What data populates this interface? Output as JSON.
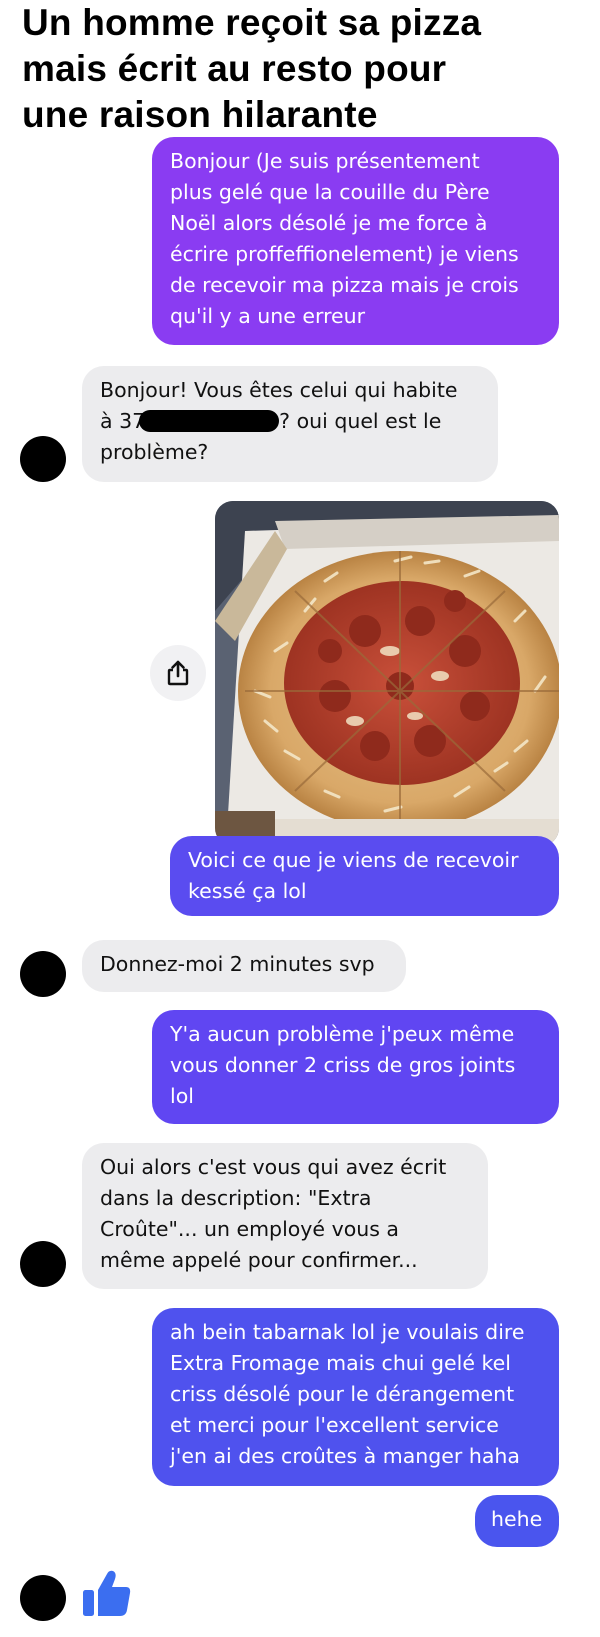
{
  "headline": {
    "line1": "Un homme reçoit sa pizza",
    "line2": "mais écrit au resto pour",
    "line3": "une raison hilarante"
  },
  "conversation": {
    "messages": [
      {
        "sender": "me",
        "lines": [
          "Bonjour (Je suis présentement",
          "plus gelé que la couille du Père",
          "Noël alors désolé je me force à",
          "écrire proffeffionelement) je viens",
          "de recevoir ma pizza mais je crois",
          "qu'il y a une erreur"
        ]
      },
      {
        "sender": "restaurant",
        "lines": [
          "Bonjour! Vous êtes celui qui habite",
          "à 37",
          "? oui quel est le",
          "problème?"
        ]
      },
      {
        "sender": "me",
        "type": "photo",
        "description_icon": "pizza-photo"
      },
      {
        "sender": "me",
        "lines": [
          "Voici ce que je viens de recevoir",
          "kessé ça lol"
        ]
      },
      {
        "sender": "restaurant",
        "lines": [
          "Donnez-moi 2 minutes svp"
        ]
      },
      {
        "sender": "me",
        "lines": [
          "Y'a aucun problème j'peux même",
          "vous donner 2 criss de gros joints",
          "lol"
        ]
      },
      {
        "sender": "restaurant",
        "lines": [
          "Oui alors c'est vous qui avez écrit",
          "dans la description: \"Extra",
          "Croûte\"... un employé vous a",
          "même appelé pour confirmer..."
        ]
      },
      {
        "sender": "me",
        "lines": [
          "ah bein tabarnak lol je voulais dire",
          "Extra Fromage mais chui gelé kel",
          "criss désolé pour le dérangement",
          "et merci pour l'excellent service",
          "j'en ai des croûtes à manger haha"
        ]
      },
      {
        "sender": "me",
        "lines": [
          "hehe"
        ]
      }
    ]
  },
  "icons": {
    "share": "share-icon",
    "like": "thumbs-up-icon"
  },
  "colors": {
    "outgoing_purple": "#8a3cf2",
    "outgoing_violet": "#6a46f2",
    "outgoing_blue": "#4f52ee",
    "incoming": "#ececee",
    "like_blue": "#3b6ef0"
  }
}
